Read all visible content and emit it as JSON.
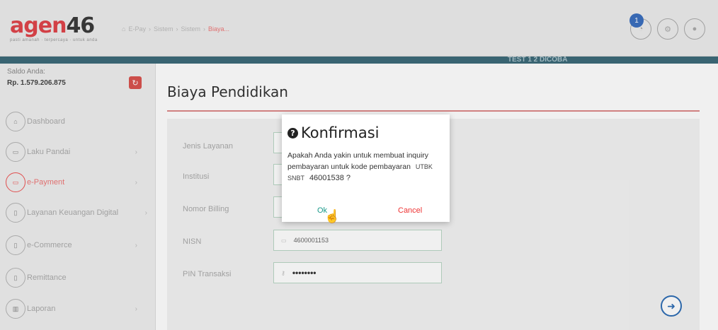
{
  "header": {
    "logo_main": "agen",
    "logo_num": "46",
    "logo_tagline": "pasti amanah · terpercaya · untuk anda",
    "breadcrumb": [
      "E-Pay",
      "Sistem",
      "Sistem",
      "Biaya..."
    ],
    "notification_count": "1",
    "strip_text": "TEST 1 2 DICOBA"
  },
  "sidebar": {
    "saldo_label": "Saldo Anda:",
    "saldo_value": "Rp. 1.579.206.875",
    "items": [
      {
        "label": "Dashboard",
        "icon": "home-icon"
      },
      {
        "label": "Laku Pandai",
        "icon": "card-icon"
      },
      {
        "label": "e-Payment",
        "icon": "card-icon"
      },
      {
        "label": "Layanan Keuangan Digital",
        "icon": "phone-icon"
      },
      {
        "label": "e-Commerce",
        "icon": "phone-icon"
      },
      {
        "label": "Remittance",
        "icon": "phone-icon"
      },
      {
        "label": "Laporan",
        "icon": "chart-icon"
      }
    ]
  },
  "main": {
    "title": "Biaya Pendidikan",
    "fields": [
      {
        "label": "Jenis Layanan",
        "value": ""
      },
      {
        "label": "Institusi",
        "value": ""
      },
      {
        "label": "Nomor Billing",
        "value": ""
      },
      {
        "label": "NISN",
        "value": "4600001153"
      },
      {
        "label": "PIN Transaksi",
        "value": "••••••••"
      }
    ]
  },
  "dialog": {
    "title": "Konfirmasi",
    "message": "Apakah Anda yakin untuk membuat inquiry pembayaran untuk kode pembayaran",
    "code_label": "UTBK SNBT",
    "code_number": "46001538 ?",
    "ok_label": "Ok",
    "cancel_label": "Cancel"
  }
}
